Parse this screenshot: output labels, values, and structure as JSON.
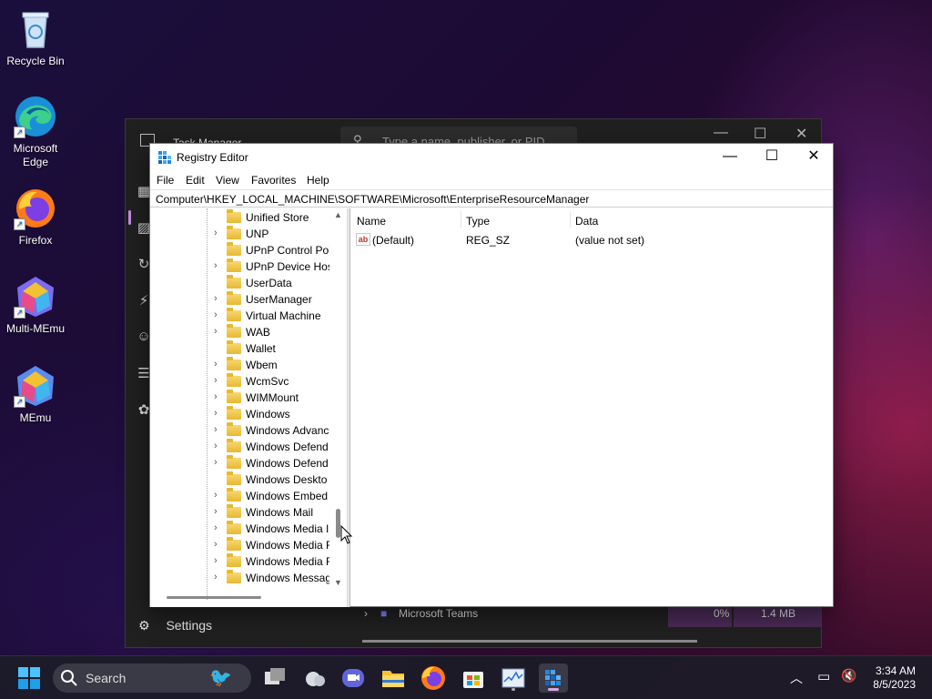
{
  "desktop": {
    "icons": [
      {
        "label": "Recycle Bin"
      },
      {
        "label": "Microsoft Edge"
      },
      {
        "label": "Firefox"
      },
      {
        "label": "Multi-MEmu"
      },
      {
        "label": "MEmu"
      }
    ]
  },
  "task_manager": {
    "title": "Task Manager",
    "search_placeholder": "Type a name, publisher, or PID",
    "settings_label": "Settings",
    "row": {
      "name": "Microsoft Teams",
      "cpu": "0%",
      "memory": "1.4 MB"
    }
  },
  "regedit": {
    "title": "Registry Editor",
    "menu": [
      "File",
      "Edit",
      "View",
      "Favorites",
      "Help"
    ],
    "address": "Computer\\HKEY_LOCAL_MACHINE\\SOFTWARE\\Microsoft\\EnterpriseResourceManager",
    "tree": [
      {
        "label": "Unified Store",
        "expandable": false
      },
      {
        "label": "UNP",
        "expandable": true
      },
      {
        "label": "UPnP Control Poi",
        "expandable": false
      },
      {
        "label": "UPnP Device Hos",
        "expandable": true
      },
      {
        "label": "UserData",
        "expandable": false
      },
      {
        "label": "UserManager",
        "expandable": true
      },
      {
        "label": "Virtual Machine",
        "expandable": true
      },
      {
        "label": "WAB",
        "expandable": true
      },
      {
        "label": "Wallet",
        "expandable": false
      },
      {
        "label": "Wbem",
        "expandable": true
      },
      {
        "label": "WcmSvc",
        "expandable": true
      },
      {
        "label": "WIMMount",
        "expandable": true
      },
      {
        "label": "Windows",
        "expandable": true
      },
      {
        "label": "Windows Advanc",
        "expandable": true
      },
      {
        "label": "Windows Defend",
        "expandable": true
      },
      {
        "label": "Windows Defend",
        "expandable": true
      },
      {
        "label": "Windows Deskto",
        "expandable": false
      },
      {
        "label": "Windows Embed",
        "expandable": true
      },
      {
        "label": "Windows Mail",
        "expandable": true
      },
      {
        "label": "Windows Media I",
        "expandable": true
      },
      {
        "label": "Windows Media F",
        "expandable": true
      },
      {
        "label": "Windows Media F",
        "expandable": true
      },
      {
        "label": "Windows Messag",
        "expandable": true
      }
    ],
    "columns": {
      "name": "Name",
      "type": "Type",
      "data": "Data"
    },
    "values": [
      {
        "name": "(Default)",
        "type": "REG_SZ",
        "data": "(value not set)"
      }
    ]
  },
  "taskbar": {
    "search_label": "Search",
    "time": "3:34 AM",
    "date": "8/5/2023"
  },
  "colors": {
    "accent": "#0067c0",
    "folder": "#f1c84b",
    "taskbar_indicator": "#d9a5e8"
  }
}
